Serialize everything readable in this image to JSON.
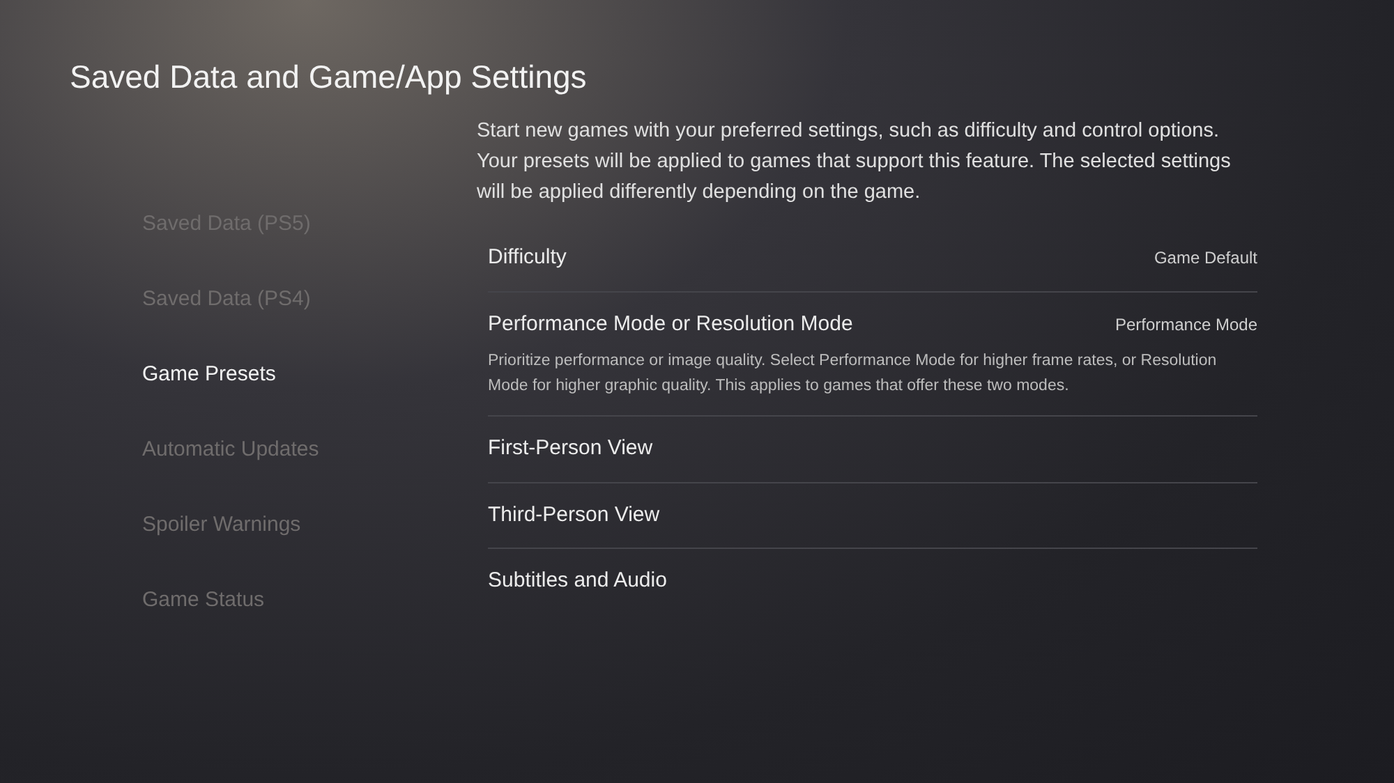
{
  "title": "Saved Data and Game/App Settings",
  "sidebar": {
    "items": [
      {
        "label": "Saved Data (PS5)",
        "selected": false
      },
      {
        "label": "Saved Data (PS4)",
        "selected": false
      },
      {
        "label": "Game Presets",
        "selected": true
      },
      {
        "label": "Automatic Updates",
        "selected": false
      },
      {
        "label": "Spoiler Warnings",
        "selected": false
      },
      {
        "label": "Game Status",
        "selected": false
      }
    ]
  },
  "description": "Start new games with your preferred settings, such as difficulty and control options. Your presets will be applied to games that support this feature. The selected settings will be applied differently depending on the game.",
  "settings": [
    {
      "label": "Difficulty",
      "value": "Game Default"
    },
    {
      "label": "Performance Mode or Resolution Mode",
      "value": "Performance Mode",
      "description": "Prioritize performance or image quality. Select Performance Mode for higher frame rates, or Resolution Mode for higher graphic quality. This applies to games that offer these two modes."
    },
    {
      "label": "First-Person View"
    },
    {
      "label": "Third-Person View"
    },
    {
      "label": "Subtitles and Audio"
    }
  ]
}
